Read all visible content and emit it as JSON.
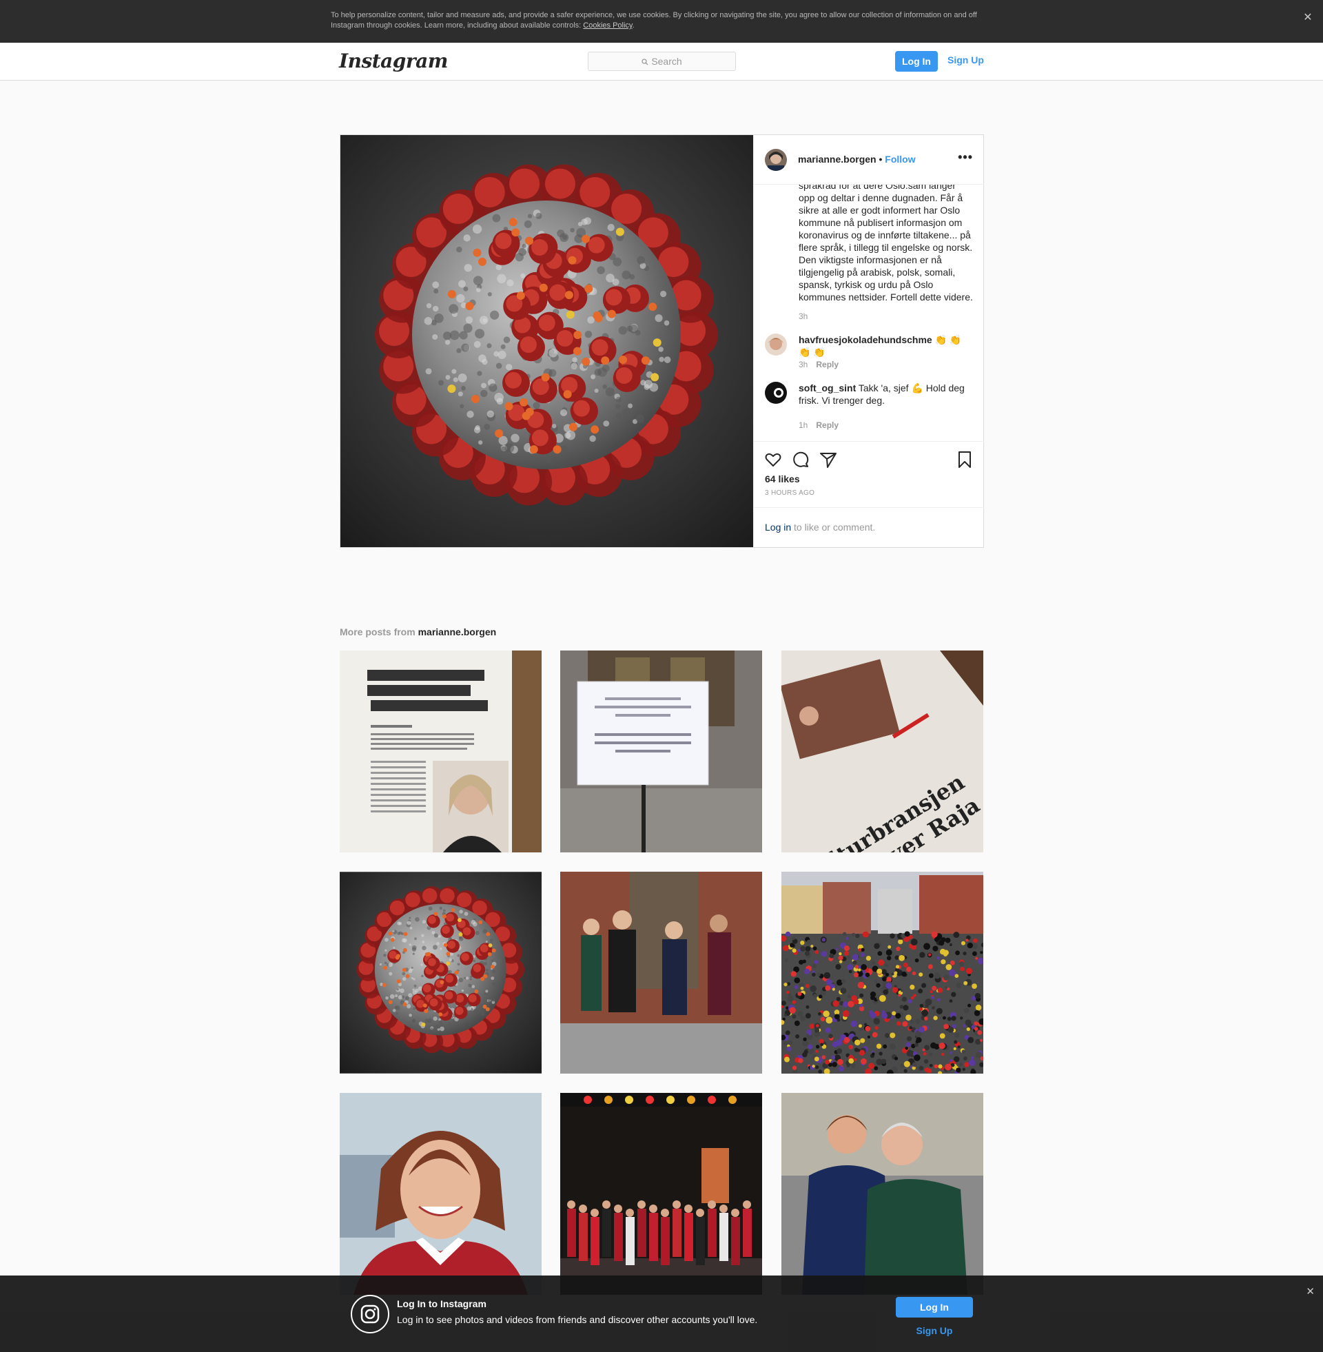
{
  "cookie_banner": {
    "text": "To help personalize content, tailor and measure ads, and provide a safer experience, we use cookies. By clicking or navigating the site, you agree to allow our collection of information on and off Instagram through cookies. Learn more, including about available controls: ",
    "link": "Cookies Policy",
    "end": ".",
    "close": "✕"
  },
  "header": {
    "logo": "Instagram",
    "search_placeholder": "Search",
    "login": "Log In",
    "signup": "Sign Up"
  },
  "post": {
    "username": "marianne.borgen",
    "separator": " • ",
    "follow": "Follow",
    "more": "•••",
    "caption": "språkråd for at dere Oslo.sam langer\nopp og deltar i denne dugnaden. Får å sikre at alle er godt informert har Oslo kommune nå publisert informasjon om koronavirus og de innførte tiltakene... på flere språk, i tillegg til engelske og norsk. Den viktigste informasjonen er nå tilgjengelig på arabisk, polsk, somali, spansk, tyrkisk og urdu på Oslo kommunes nettsider. Fortell dette videre.",
    "caption_time": "3h",
    "comments": [
      {
        "user": "havfruesjokoladehundschme",
        "text": " 👏 👏 👏 👏",
        "time": "3h",
        "reply": "Reply"
      },
      {
        "user": "soft_og_sint",
        "text": " Takk 'a, sjef 💪 Hold deg frisk. Vi trenger deg.",
        "time": "1h",
        "reply": "Reply"
      }
    ],
    "likes": "64 likes",
    "time_ago": "3 HOURS AGO",
    "login_link": "Log in",
    "login_rest": " to like or comment."
  },
  "more_posts": {
    "prefix": "More posts from ",
    "username": "marianne.borgen"
  },
  "bottom_bar": {
    "title": "Log In to Instagram",
    "subtitle": "Log in to see photos and videos from friends and discover other accounts you'll love.",
    "login": "Log In",
    "signup": "Sign Up",
    "close": "✕"
  },
  "colors": {
    "accent": "#3897f0",
    "banner_bg": "#2d2d2d",
    "virus_red": "#b3221f"
  }
}
